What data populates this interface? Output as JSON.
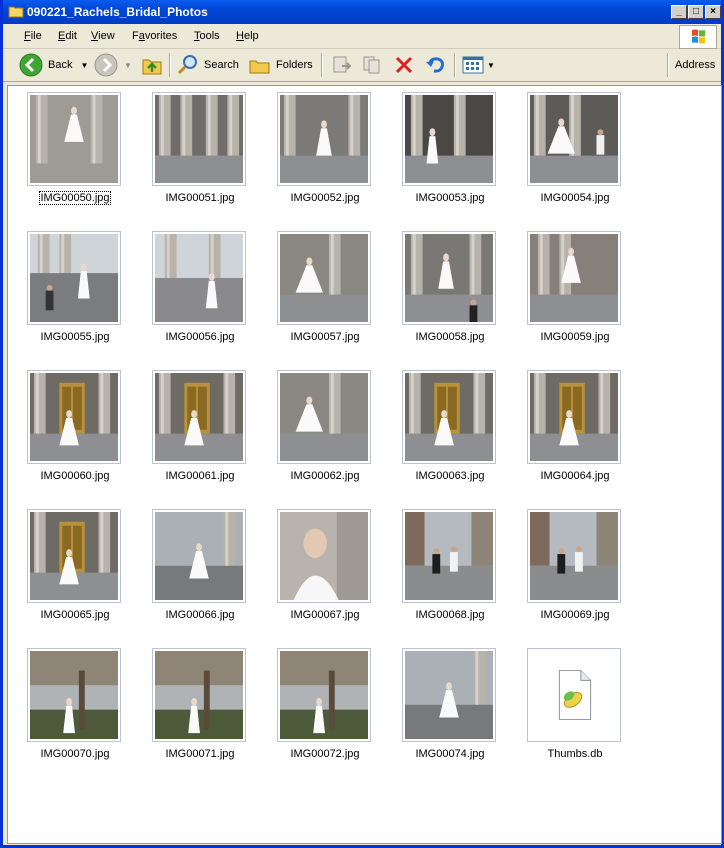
{
  "window": {
    "title": "090221_Rachels_Bridal_Photos"
  },
  "menu": [
    {
      "label": "File",
      "u": "F",
      "rest": "ile"
    },
    {
      "label": "Edit",
      "u": "E",
      "rest": "dit"
    },
    {
      "label": "View",
      "u": "V",
      "rest": "iew"
    },
    {
      "label": "Favorites",
      "u": "F",
      "pre": "",
      "rest": "avorites",
      "mid": "a",
      "pre2": "F"
    },
    {
      "label": "Tools",
      "u": "T",
      "rest": "ools"
    },
    {
      "label": "Help",
      "u": "H",
      "rest": "elp"
    }
  ],
  "toolbar": {
    "back_label": "Back",
    "search_label": "Search",
    "folders_label": "Folders",
    "address_label": "Address"
  },
  "files": [
    {
      "name": "IMG00050.jpg",
      "selected": true,
      "scene": "column-bride"
    },
    {
      "name": "IMG00051.jpg",
      "scene": "columns"
    },
    {
      "name": "IMG00052.jpg",
      "scene": "columns-bride"
    },
    {
      "name": "IMG00053.jpg",
      "scene": "dark-bride"
    },
    {
      "name": "IMG00054.jpg",
      "scene": "bride-groom"
    },
    {
      "name": "IMG00055.jpg",
      "scene": "photographer"
    },
    {
      "name": "IMG00056.jpg",
      "scene": "steps-bride"
    },
    {
      "name": "IMG00057.jpg",
      "scene": "bride-train"
    },
    {
      "name": "IMG00058.jpg",
      "scene": "photographer2"
    },
    {
      "name": "IMG00059.jpg",
      "scene": "bride-stand"
    },
    {
      "name": "IMG00060.jpg",
      "scene": "gold-door"
    },
    {
      "name": "IMG00061.jpg",
      "scene": "gold-door"
    },
    {
      "name": "IMG00062.jpg",
      "scene": "bride-train"
    },
    {
      "name": "IMG00063.jpg",
      "scene": "gold-door"
    },
    {
      "name": "IMG00064.jpg",
      "scene": "gold-door"
    },
    {
      "name": "IMG00065.jpg",
      "scene": "gold-door"
    },
    {
      "name": "IMG00066.jpg",
      "scene": "street-bride"
    },
    {
      "name": "IMG00067.jpg",
      "scene": "portrait"
    },
    {
      "name": "IMG00068.jpg",
      "scene": "street-people"
    },
    {
      "name": "IMG00069.jpg",
      "scene": "street-people"
    },
    {
      "name": "IMG00070.jpg",
      "scene": "plaza"
    },
    {
      "name": "IMG00071.jpg",
      "scene": "plaza"
    },
    {
      "name": "IMG00072.jpg",
      "scene": "plaza"
    },
    {
      "name": "IMG00074.jpg",
      "scene": "street-bride"
    },
    {
      "name": "Thumbs.db",
      "scene": "db-file"
    }
  ]
}
